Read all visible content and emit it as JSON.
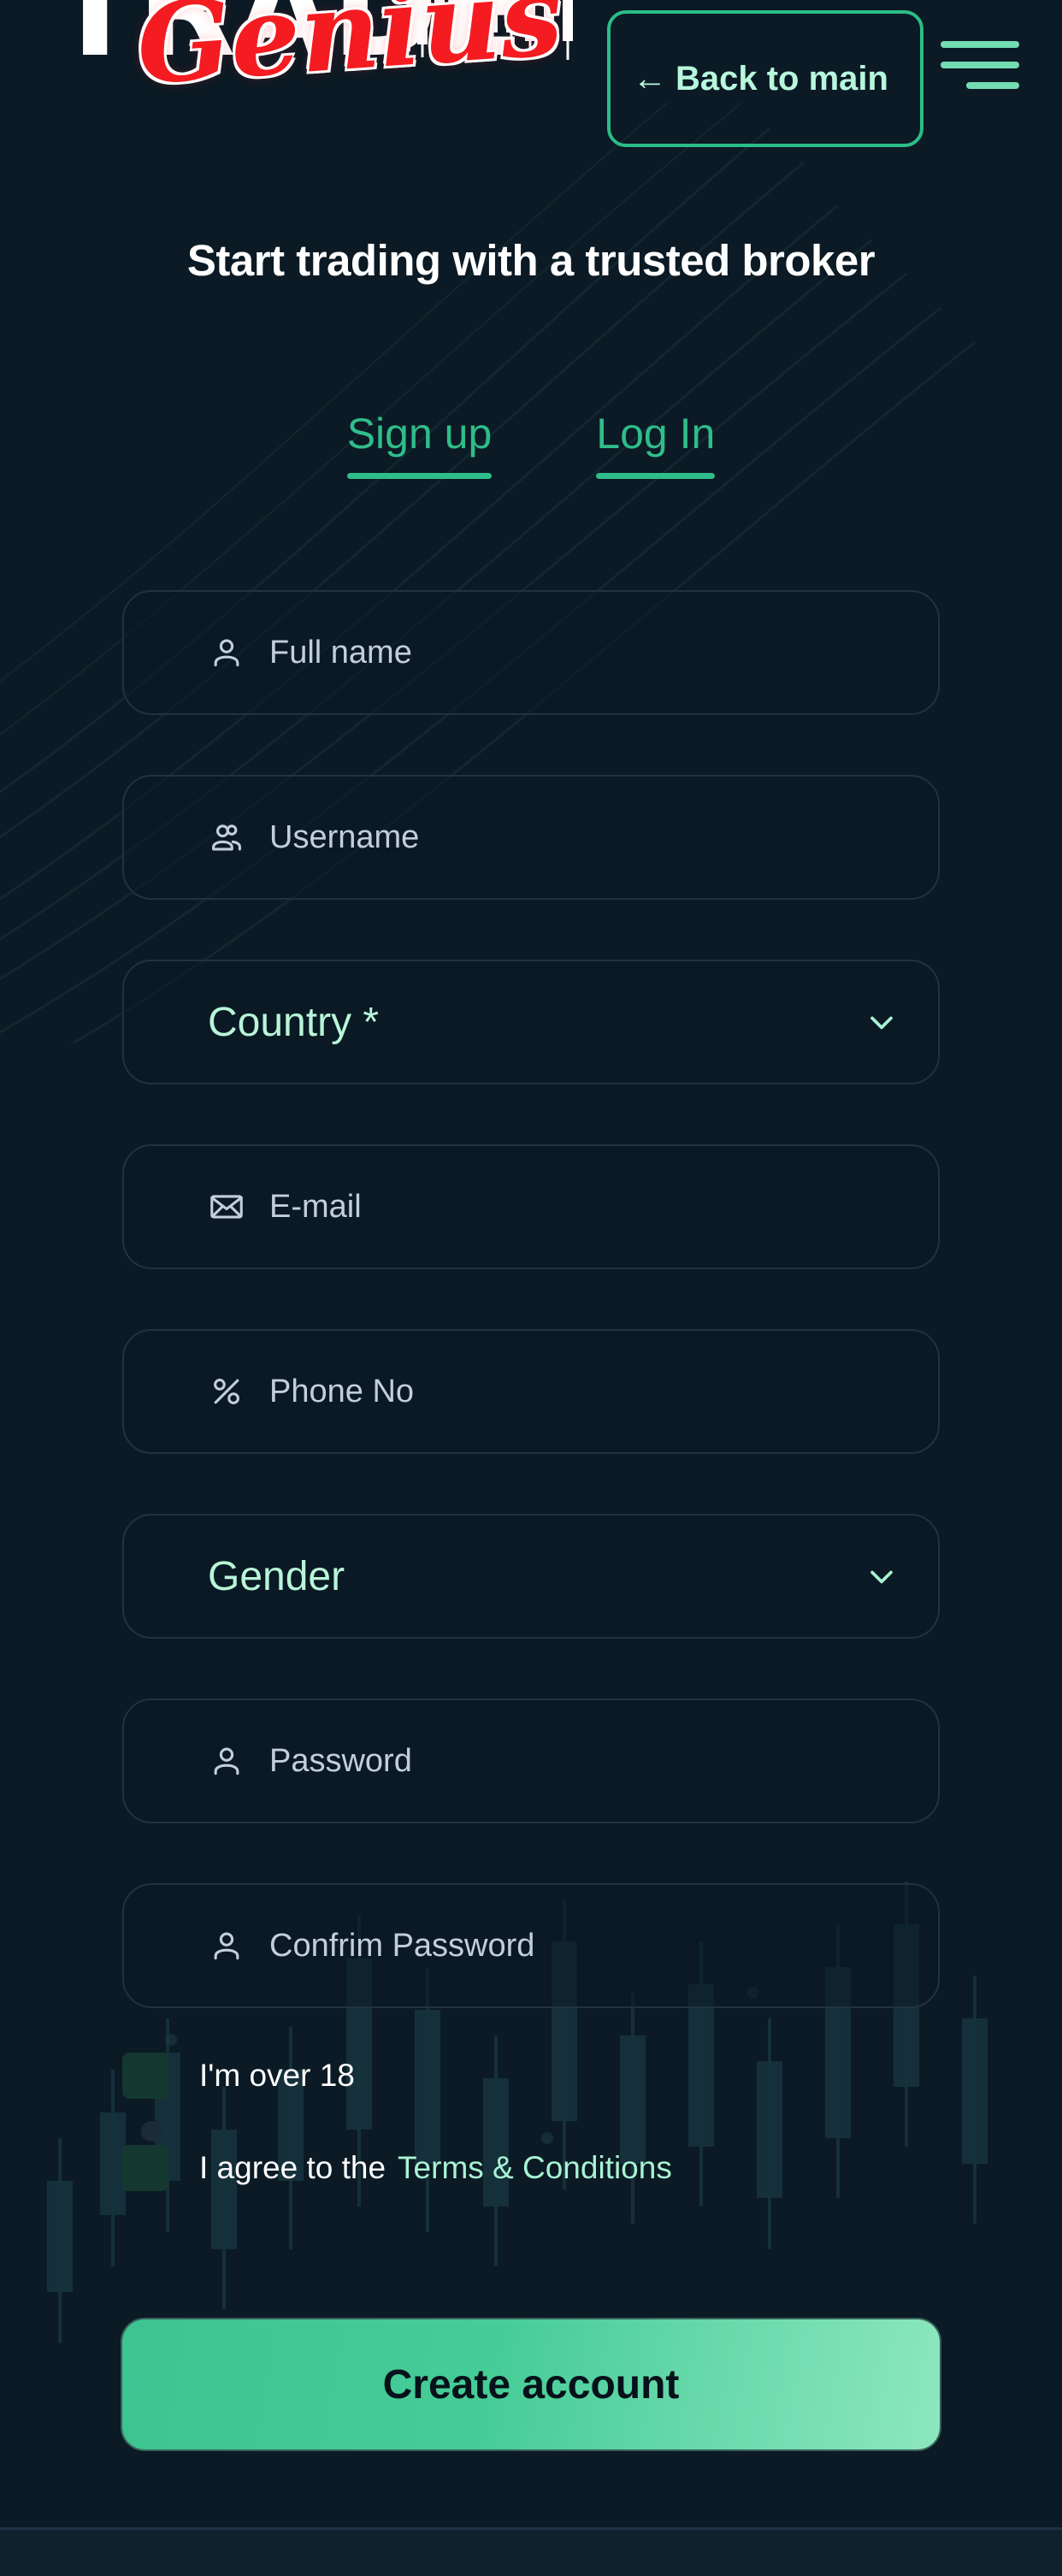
{
  "header": {
    "logo_primary": "TRADE",
    "logo_script": "Genius",
    "back_button_label": "Back to main",
    "back_button_arrow": "←",
    "menu_icon": "hamburger-menu-icon"
  },
  "tagline": "Start trading with a trusted broker",
  "tabs": [
    {
      "label": "Sign up",
      "active": true
    },
    {
      "label": "Log In",
      "active": false
    }
  ],
  "form": {
    "fields": [
      {
        "type": "text",
        "icon": "person-icon",
        "placeholder": "Full name",
        "value": ""
      },
      {
        "type": "text",
        "icon": "people-icon",
        "placeholder": "Username",
        "value": ""
      },
      {
        "type": "select",
        "icon": "chevron-down-icon",
        "label": "Country *",
        "value": ""
      },
      {
        "type": "email",
        "icon": "envelope-icon",
        "placeholder": "E-mail",
        "value": ""
      },
      {
        "type": "tel",
        "icon": "percent-icon",
        "placeholder": "Phone No",
        "value": ""
      },
      {
        "type": "select",
        "icon": "chevron-down-icon",
        "label": "Gender",
        "value": ""
      },
      {
        "type": "password",
        "icon": "person-icon",
        "placeholder": "Password",
        "value": ""
      },
      {
        "type": "password",
        "icon": "person-icon",
        "placeholder": "Confrim Password",
        "value": ""
      }
    ]
  },
  "checkboxes": {
    "over18_label": "I'm over 18",
    "over18_checked": false,
    "terms_label": "I agree to the",
    "terms_link": "Terms & Conditions",
    "terms_checked": false
  },
  "submit_label": "Create account",
  "colors": {
    "background": "#0b1a24",
    "accent_green": "#2fbd8a",
    "mint": "#b8f5d9",
    "logo_red": "#f41c21",
    "text_primary": "#ffffff",
    "placeholder": "#c2cfdb",
    "field_border": "#223240",
    "checkbox_fill": "#14382f"
  }
}
